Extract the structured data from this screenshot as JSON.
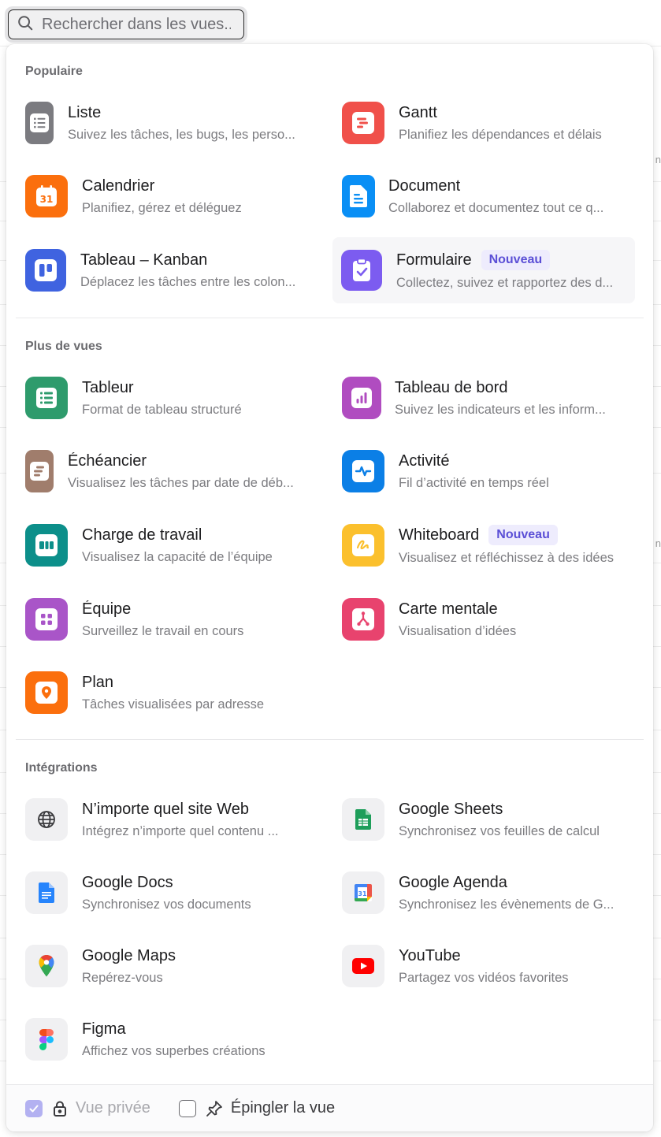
{
  "search": {
    "placeholder": "Rechercher dans les vues..."
  },
  "background": {
    "fragment": "n"
  },
  "sections": {
    "popular": {
      "title": "Populaire",
      "items": [
        {
          "title": "Liste",
          "desc": "Suivez les tâches, les bugs, les perso...",
          "icon": "list-icon",
          "color": "#7b7b80"
        },
        {
          "title": "Gantt",
          "desc": "Planifiez les dépendances et délais",
          "icon": "gantt-icon",
          "color": "#f0504a"
        },
        {
          "title": "Calendrier",
          "desc": "Planifiez, gérez et déléguez",
          "icon": "calendar-icon",
          "color": "#fb6f0d",
          "date": "31"
        },
        {
          "title": "Document",
          "desc": "Collaborez et documentez tout ce q...",
          "icon": "document-icon",
          "color": "#0a8ff5"
        },
        {
          "title": "Tableau – Kanban",
          "desc": "Déplacez les tâches entre les colon...",
          "icon": "kanban-icon",
          "color": "#3f63e0"
        },
        {
          "title": "Formulaire",
          "badge": "Nouveau",
          "desc": "Collectez, suivez et rapportez des d...",
          "icon": "form-icon",
          "color": "#7c5cf0"
        }
      ]
    },
    "more": {
      "title": "Plus de vues",
      "items": [
        {
          "title": "Tableur",
          "desc": "Format de tableau structuré",
          "icon": "spreadsheet-icon",
          "color": "#2e9b6c"
        },
        {
          "title": "Tableau de bord",
          "desc": "Suivez les indicateurs et les inform...",
          "icon": "dashboard-icon",
          "color": "#b04cc0"
        },
        {
          "title": "Échéancier",
          "desc": "Visualisez les tâches par date de déb...",
          "icon": "timeline-icon",
          "color": "#a07d6c"
        },
        {
          "title": "Activité",
          "desc": "Fil d’activité en temps réel",
          "icon": "activity-icon",
          "color": "#0b7fe6"
        },
        {
          "title": "Charge de travail",
          "desc": "Visualisez la capacité de l’équipe",
          "icon": "workload-icon",
          "color": "#0c8f8a"
        },
        {
          "title": "Whiteboard",
          "badge": "Nouveau",
          "desc": "Visualisez et réfléchissez à des idées",
          "icon": "whiteboard-icon",
          "color": "#fbc02d"
        },
        {
          "title": "Équipe",
          "desc": "Surveillez le travail en cours",
          "icon": "team-icon",
          "color": "#a955c8"
        },
        {
          "title": "Carte mentale",
          "desc": "Visualisation d’idées",
          "icon": "mindmap-icon",
          "color": "#e8436e"
        },
        {
          "title": "Plan",
          "desc": "Tâches visualisées par adresse",
          "icon": "map-pin-icon",
          "color": "#fb6f0d"
        }
      ]
    },
    "integrations": {
      "title": "Intégrations",
      "items": [
        {
          "title": "N’importe quel site Web",
          "desc": "Intégrez n’importe quel contenu ...",
          "icon": "globe-icon"
        },
        {
          "title": "Google Sheets",
          "desc": "Synchronisez vos feuilles de calcul",
          "icon": "google-sheets-icon"
        },
        {
          "title": "Google Docs",
          "desc": "Synchronisez vos documents",
          "icon": "google-docs-icon"
        },
        {
          "title": "Google Agenda",
          "desc": "Synchronisez les évènements de G...",
          "icon": "google-calendar-icon",
          "date": "31"
        },
        {
          "title": "Google Maps",
          "desc": "Repérez-vous",
          "icon": "google-maps-icon"
        },
        {
          "title": "YouTube",
          "desc": "Partagez vos vidéos favorites",
          "icon": "youtube-icon"
        },
        {
          "title": "Figma",
          "desc": "Affichez vos superbes créations",
          "icon": "figma-icon"
        }
      ]
    }
  },
  "footer": {
    "private_label": "Vue privée",
    "pin_label": "Épingler la vue"
  }
}
